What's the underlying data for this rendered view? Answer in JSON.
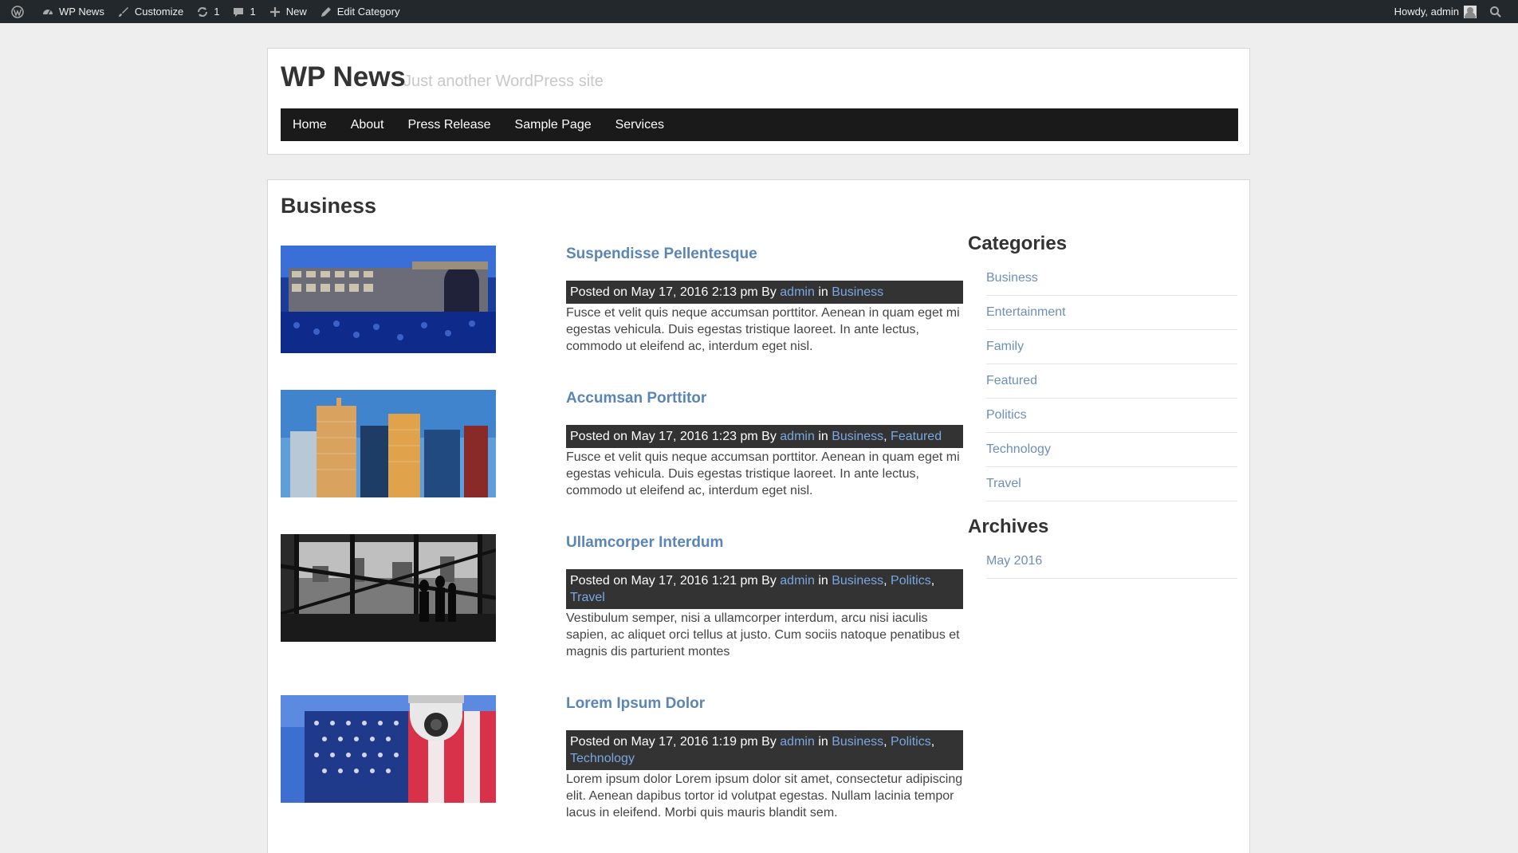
{
  "adminbar": {
    "site_name": "WP News",
    "customize": "Customize",
    "updates_count": "1",
    "comments_count": "1",
    "new_label": "New",
    "edit_category": "Edit Category",
    "howdy": "Howdy, admin"
  },
  "header": {
    "title": "WP News",
    "description": "Just another WordPress site"
  },
  "nav": [
    "Home",
    "About",
    "Press Release",
    "Sample Page",
    "Services"
  ],
  "page": {
    "title": "Business"
  },
  "posts": [
    {
      "title": "Suspendisse Pellentesque",
      "meta_prefix": "Posted on May 17, 2016 2:13 pm By",
      "author": "admin",
      "in_label": "in",
      "categories": [
        "Business"
      ],
      "excerpt": "Fusce et velit quis neque accumsan porttitor. Aenean in quam eget mi egestas vehicula. Duis egestas tristique laoreet. In ante lectus, commodo ut eleifend ac, interdum eget nisl."
    },
    {
      "title": "Accumsan Porttitor",
      "meta_prefix": "Posted on May 17, 2016 1:23 pm By",
      "author": "admin",
      "in_label": "in",
      "categories": [
        "Business",
        "Featured"
      ],
      "excerpt": "Fusce et velit quis neque accumsan porttitor. Aenean in quam eget mi egestas vehicula. Duis egestas tristique laoreet. In ante lectus, commodo ut eleifend ac, interdum eget nisl."
    },
    {
      "title": "Ullamcorper Interdum",
      "meta_prefix": "Posted on May 17, 2016 1:21 pm By",
      "author": "admin",
      "in_label": "in",
      "categories": [
        "Business",
        "Politics",
        "Travel"
      ],
      "excerpt": "Vestibulum semper, nisi a ullamcorper interdum, arcu nisi iaculis sapien, ac aliquet orci tellus at justo. Cum sociis natoque penatibus et magnis dis parturient montes"
    },
    {
      "title": "Lorem Ipsum Dolor",
      "meta_prefix": "Posted on May 17, 2016 1:19 pm By",
      "author": "admin",
      "in_label": "in",
      "categories": [
        "Business",
        "Politics",
        "Technology"
      ],
      "excerpt": "Lorem ipsum dolor Lorem ipsum dolor sit amet, consectetur adipiscing elit. Aenean dapibus tortor id volutpat egestas. Nullam lacinia tempor lacus in eleifend. Morbi quis mauris blandit sem."
    }
  ],
  "sidebar": {
    "categories_title": "Categories",
    "categories": [
      "Business",
      "Entertainment",
      "Family",
      "Featured",
      "Politics",
      "Technology",
      "Travel"
    ],
    "archives_title": "Archives",
    "archives": [
      "May 2016"
    ]
  },
  "colors": {
    "adminbar_bg": "#23282d",
    "nav_bg": "#1a1a1a",
    "meta_bg": "#333333",
    "link": "#5b85b6",
    "meta_link": "#7aa7e0"
  }
}
